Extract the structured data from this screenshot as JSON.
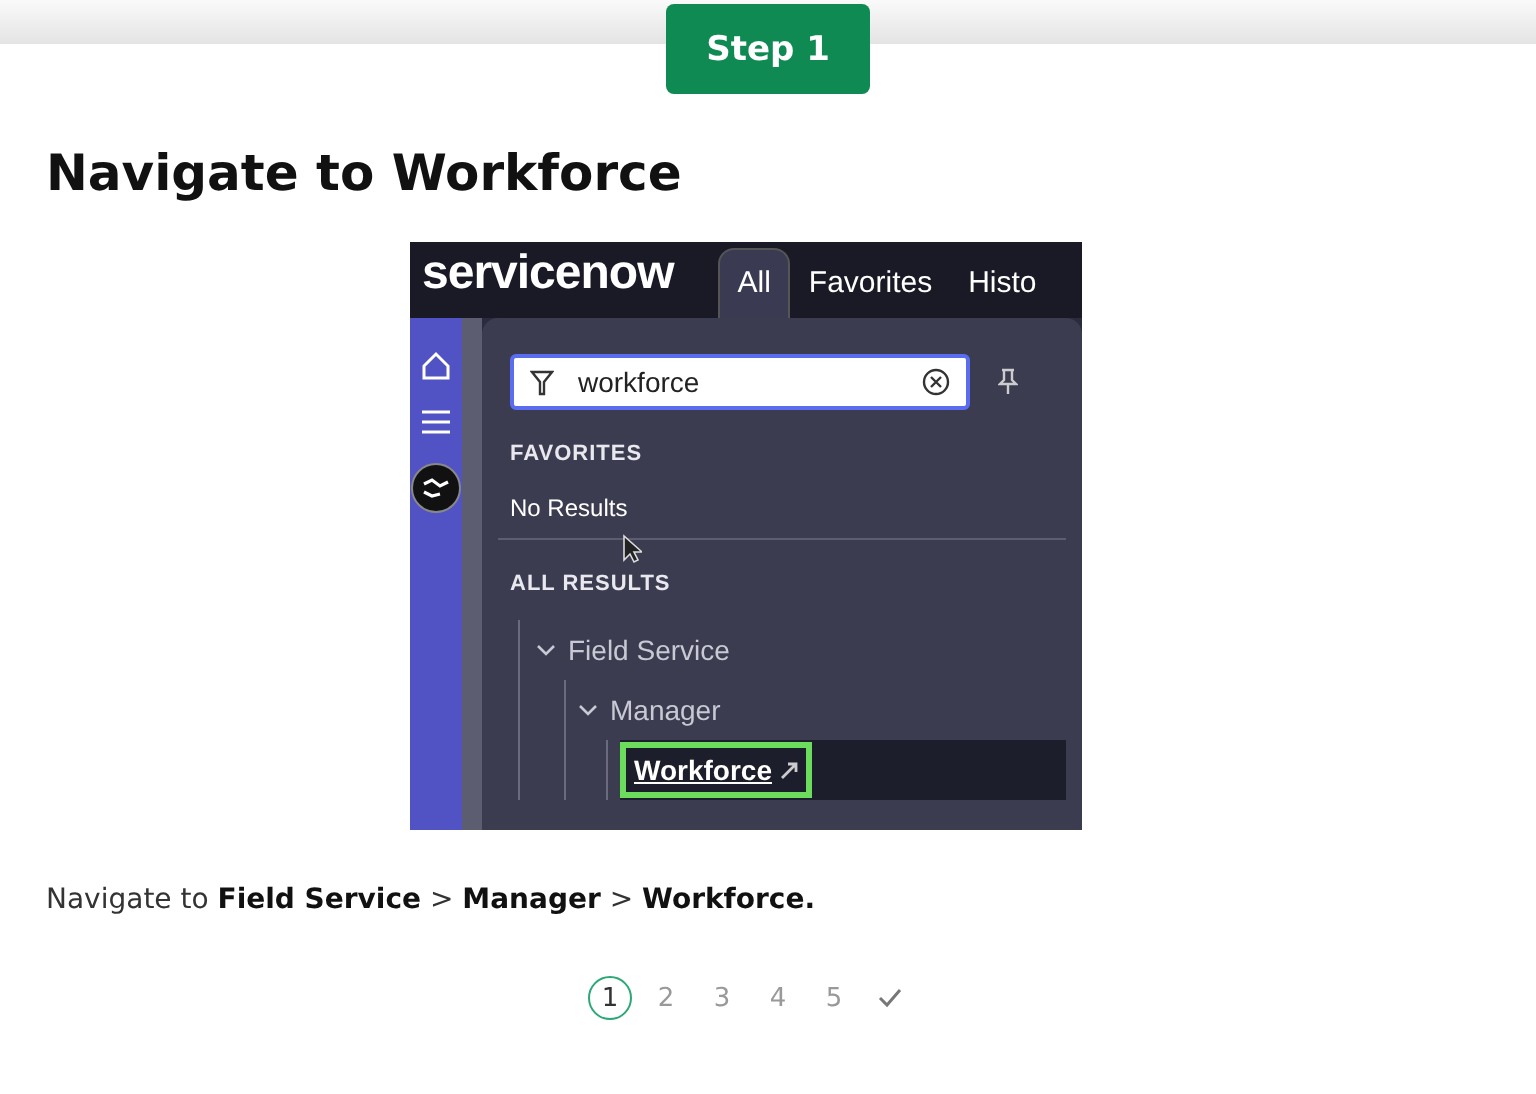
{
  "step_badge": "Step 1",
  "title": "Navigate to Workforce",
  "screenshot": {
    "logo": "servicenow",
    "tabs": [
      {
        "label": "All",
        "selected": true
      },
      {
        "label": "Favorites",
        "selected": false
      },
      {
        "label": "Histo",
        "selected": false
      }
    ],
    "search": {
      "value": "workforce"
    },
    "favorites_heading": "FAVORITES",
    "favorites_empty": "No Results",
    "results_heading": "ALL RESULTS",
    "results": [
      {
        "label": "Field Service",
        "expanded": true,
        "children": [
          {
            "label": "Manager",
            "expanded": true,
            "children": [
              {
                "label": "Workforce",
                "selected": true
              }
            ]
          }
        ]
      }
    ]
  },
  "instruction": "Navigate to **Field Service** > **Manager** > **Workforce.**",
  "pager": [
    {
      "kind": "number",
      "label": "1",
      "selected": true
    },
    {
      "kind": "number",
      "label": "2",
      "selected": false
    },
    {
      "kind": "number",
      "label": "3",
      "selected": false
    },
    {
      "kind": "number",
      "label": "4",
      "selected": false
    },
    {
      "kind": "number",
      "label": "5",
      "selected": false
    },
    {
      "kind": "check",
      "selected": false
    }
  ]
}
